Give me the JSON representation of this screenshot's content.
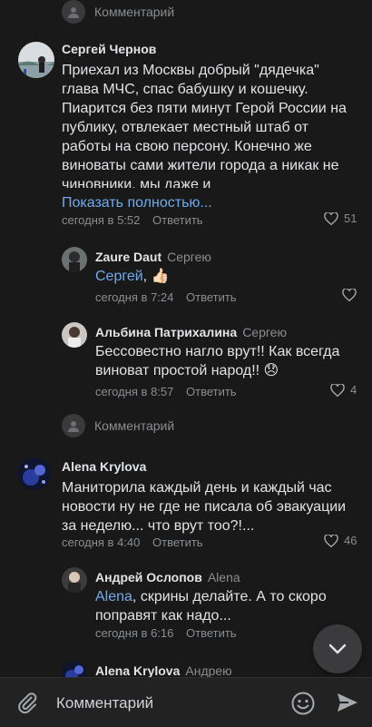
{
  "reply_links": {
    "top": "Комментарий",
    "middle": "Комментарий"
  },
  "comments": [
    {
      "author": "Сергей Чернов",
      "text": "Приехал из Москвы добрый \"дядечка\" глава МЧС, спас бабушку и кошечку. Пиарится без пяти минут Герой России на публику, отвлекает местный штаб от работы на свою персону. Конечно же виноваты сами жители города а никак не чиновники, мы даже и",
      "show_more": "Показать полностью...",
      "time": "сегодня в 5:52",
      "reply": "Ответить",
      "likes": "51"
    },
    {
      "author": "Zaure Daut",
      "to": "Сергею",
      "mention": "Сергей",
      "text": ", 👍🏻",
      "time": "сегодня в 7:24",
      "reply": "Ответить"
    },
    {
      "author": "Альбина Патрихалина",
      "to": "Сергею",
      "text": "Бессовестно нагло врут!! Как всегда виноват простой народ!! 😞",
      "time": "сегодня в 8:57",
      "reply": "Ответить",
      "likes": "4"
    },
    {
      "author": "Alena Krylova",
      "text": "Маниторила каждый день и каждый час новости ну не где не писала об эвакуации за неделю... что врут тоо?!...",
      "time": "сегодня в 4:40",
      "reply": "Ответить",
      "likes": "46"
    },
    {
      "author": "Андрей Ослопов",
      "to": "Alena",
      "mention": "Alena",
      "text": ", скрины делайте. А то скоро поправят как надо...",
      "time": "сегодня в 6:16",
      "reply": "Ответить"
    },
    {
      "author": "Alena Krylova",
      "to": "Андрею"
    }
  ],
  "composer": {
    "placeholder": "Комментарий"
  },
  "colors": {
    "background": "#191919",
    "link": "#71aaeb",
    "secondary": "#8a8d91"
  }
}
